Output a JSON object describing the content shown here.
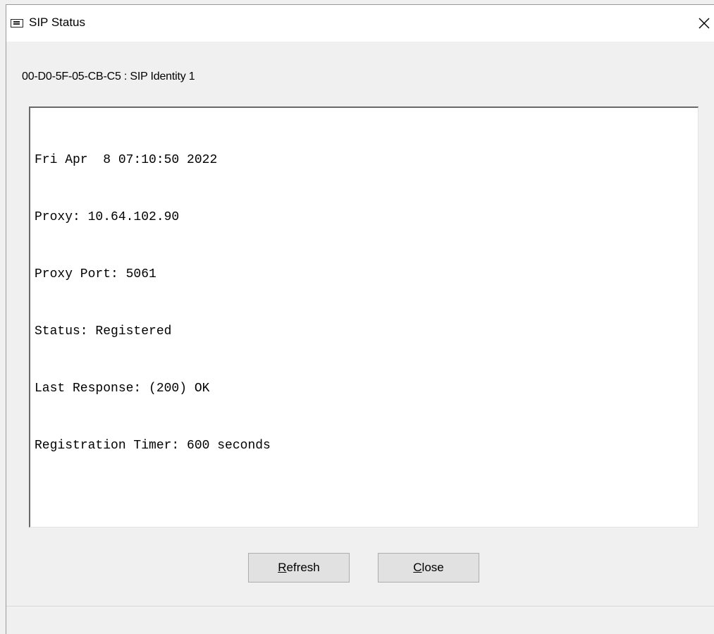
{
  "window": {
    "title": "SIP Status",
    "app_icon": "window-icon",
    "close_icon": "close-icon"
  },
  "identity_label": "00-D0-5F-05-CB-C5 : SIP Identity 1",
  "status_lines": [
    "Fri Apr  8 07:10:50 2022",
    "Proxy: 10.64.102.90",
    "Proxy Port: 5061",
    "Status: Registered",
    "Last Response: (200) OK",
    "Registration Timer: 600 seconds"
  ],
  "buttons": {
    "refresh": {
      "mnemonic": "R",
      "rest": "efresh"
    },
    "close": {
      "mnemonic": "C",
      "rest": "lose"
    }
  }
}
